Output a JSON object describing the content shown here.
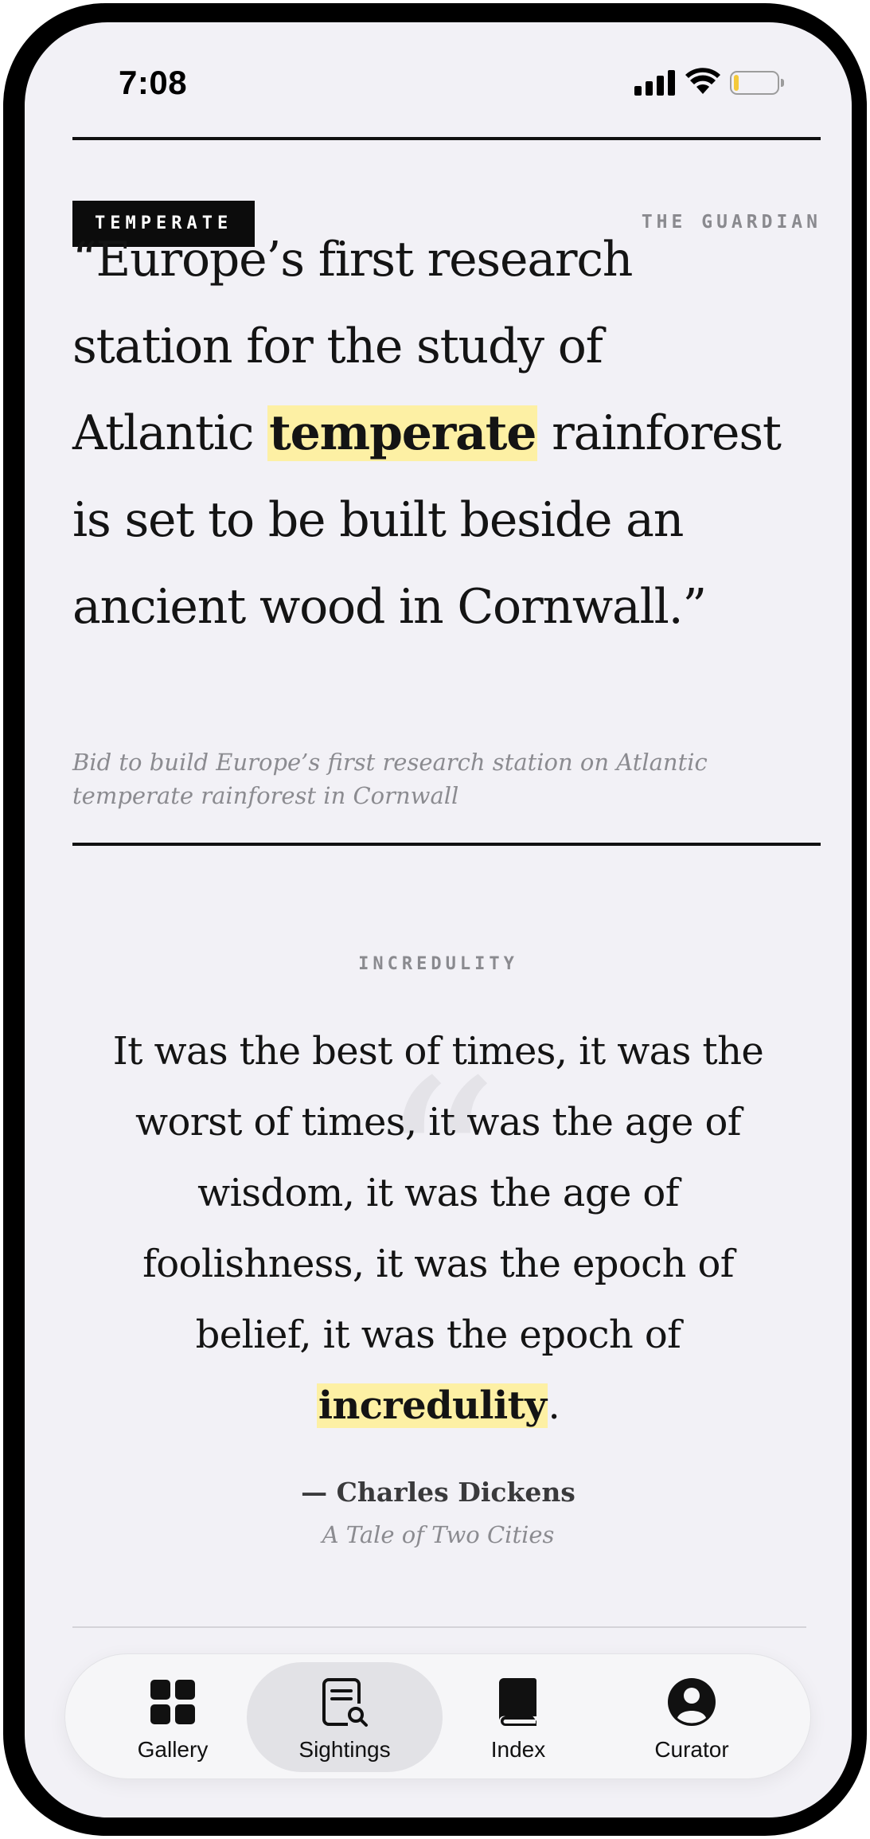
{
  "status_bar": {
    "time": "7:08"
  },
  "cards": [
    {
      "tag": "TEMPERATE",
      "source": "THE GUARDIAN",
      "quote_lines": [
        [
          "“Europe’s first research"
        ],
        [
          "station for the study of"
        ],
        [
          "Atlantic ",
          "temperate",
          " rainforest"
        ],
        [
          "is set to be built beside an"
        ],
        [
          "ancient wood in Cornwall.”"
        ]
      ],
      "highlight_word": "temperate",
      "headline": "Bid to build Europe’s first research station on Atlantic temperate rainforest in Cornwall"
    },
    {
      "label": "INCREDULITY",
      "quote_mark": "“",
      "quote_before": "It was the best of times, it was the worst of times, it was the age of wisdom, it was the age of foolishness, it was the epoch of belief, it was the epoch of ",
      "highlight_word": "incredulity",
      "quote_after": ".",
      "author": "— Charles Dickens",
      "work": "A Tale of Two Cities"
    }
  ],
  "tab_bar": {
    "tabs": [
      {
        "label": "Gallery",
        "icon": "grid-icon",
        "active": false
      },
      {
        "label": "Sightings",
        "icon": "document-search-icon",
        "active": true
      },
      {
        "label": "Index",
        "icon": "book-icon",
        "active": false
      },
      {
        "label": "Curator",
        "icon": "person-circle-icon",
        "active": false
      }
    ]
  },
  "colors": {
    "background": "#f2f1f6",
    "highlight": "#fdf0a4",
    "text": "#141414",
    "muted": "#8b8b90"
  }
}
